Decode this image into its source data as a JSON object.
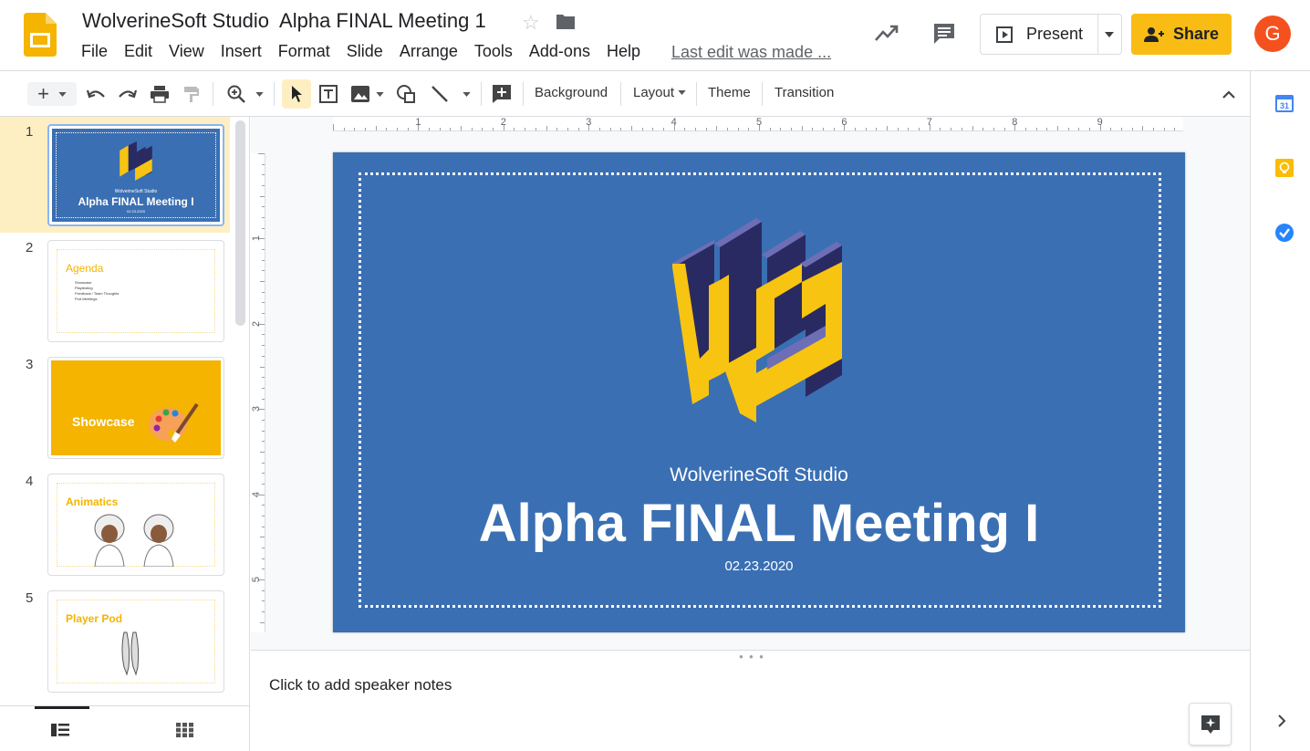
{
  "header": {
    "title": "WolverineSoft Studio  Alpha FINAL Meeting 1",
    "menu": [
      "File",
      "Edit",
      "View",
      "Insert",
      "Format",
      "Slide",
      "Arrange",
      "Tools",
      "Add-ons",
      "Help"
    ],
    "last_edit": "Last edit was made ...",
    "present_label": "Present",
    "share_label": "Share",
    "avatar_letter": "G"
  },
  "toolbar": {
    "background": "Background",
    "layout": "Layout",
    "theme": "Theme",
    "transition": "Transition"
  },
  "rulers": {
    "horizontal": [
      "1",
      "2",
      "3",
      "4",
      "5",
      "6",
      "7",
      "8",
      "9"
    ],
    "vertical": [
      "1",
      "2",
      "3",
      "4",
      "5"
    ]
  },
  "slides": [
    {
      "num": "1",
      "studio": "WolverineSoft Studio",
      "title": "Alpha FINAL Meeting I",
      "date": "02.23.2020"
    },
    {
      "num": "2",
      "title": "Agenda",
      "bullets": [
        "Showcase",
        "Playtesting",
        "Feedback / Team Thoughts",
        "Pod Meetings"
      ]
    },
    {
      "num": "3",
      "title": "Showcase"
    },
    {
      "num": "4",
      "title": "Animatics"
    },
    {
      "num": "5",
      "title": "Player Pod"
    }
  ],
  "main_slide": {
    "studio": "WolverineSoft Studio",
    "title": "Alpha FINAL Meeting I",
    "date": "02.23.2020"
  },
  "notes": {
    "placeholder": "Click to add speaker notes"
  },
  "colors": {
    "accent": "#f9bc15",
    "slide_bg": "#3a6fb3",
    "logo_yellow": "#f7c411",
    "logo_navy": "#2a2a62",
    "logo_lavender": "#6e6eb6",
    "thumb_orange": "#f4b400"
  }
}
